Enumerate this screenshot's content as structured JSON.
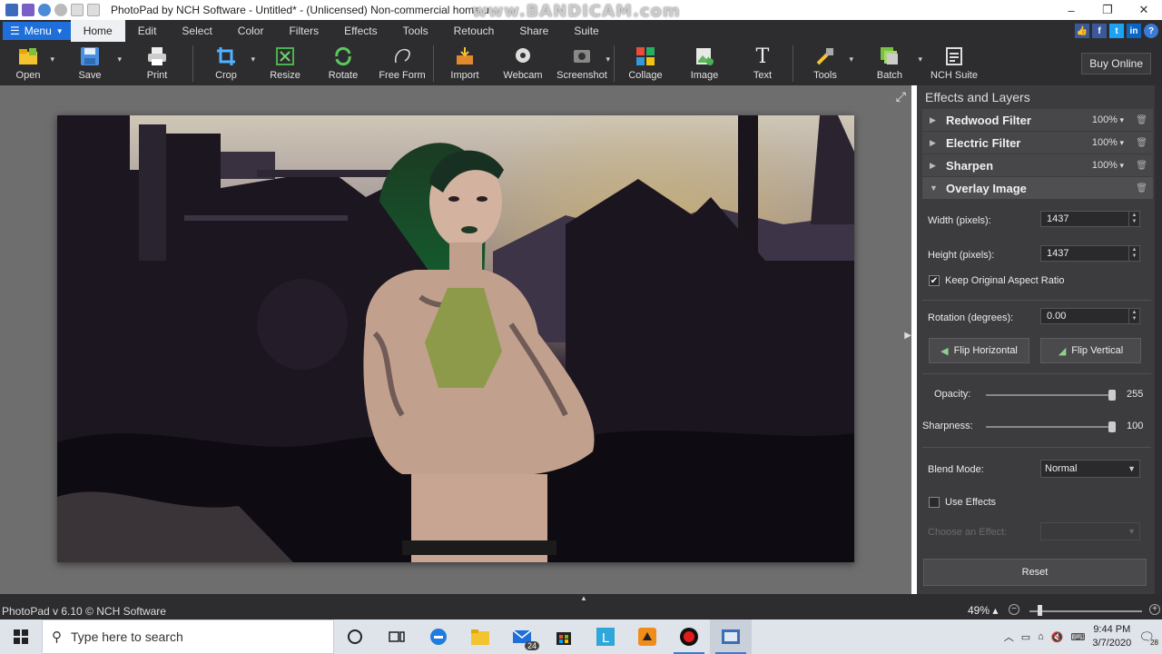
{
  "window": {
    "title": "PhotoPad by NCH Software - Untitled* - (Unlicensed) Non-commercial home u",
    "watermark": "www.BANDICAM.com",
    "minimize_glyph": "–",
    "maximize_glyph": "❐",
    "close_glyph": "✕"
  },
  "menubar": {
    "menu_label": "Menu",
    "tabs": [
      "Home",
      "Edit",
      "Select",
      "Color",
      "Filters",
      "Effects",
      "Tools",
      "Retouch",
      "Share",
      "Suite"
    ],
    "active_tab": "Home"
  },
  "toolbar": {
    "tools": [
      {
        "label": "Open",
        "icon": "folder-icon"
      },
      {
        "label": "Save",
        "icon": "save-icon"
      },
      {
        "label": "Print",
        "icon": "print-icon"
      },
      {
        "label": "Crop",
        "icon": "crop-icon"
      },
      {
        "label": "Resize",
        "icon": "resize-icon"
      },
      {
        "label": "Rotate",
        "icon": "rotate-icon"
      },
      {
        "label": "Free Form",
        "icon": "free-form-icon"
      },
      {
        "label": "Import",
        "icon": "import-icon"
      },
      {
        "label": "Webcam",
        "icon": "webcam-icon"
      },
      {
        "label": "Screenshot",
        "icon": "screenshot-icon"
      },
      {
        "label": "Collage",
        "icon": "collage-icon"
      },
      {
        "label": "Image",
        "icon": "image-icon"
      },
      {
        "label": "Text",
        "icon": "text-icon"
      },
      {
        "label": "Tools",
        "icon": "tools-icon"
      },
      {
        "label": "Batch",
        "icon": "batch-icon"
      },
      {
        "label": "NCH Suite",
        "icon": "nch-suite-icon"
      }
    ],
    "buy_online": "Buy Online"
  },
  "panel": {
    "title": "Effects and Layers",
    "layers": [
      {
        "name": "Redwood Filter",
        "percent": "100%"
      },
      {
        "name": "Electric Filter",
        "percent": "100%"
      },
      {
        "name": "Sharpen",
        "percent": "100%"
      },
      {
        "name": "Overlay Image",
        "percent": ""
      }
    ],
    "width_label": "Width (pixels):",
    "width_value": "1437",
    "height_label": "Height (pixels):",
    "height_value": "1437",
    "keep_aspect_label": "Keep Original Aspect Ratio",
    "keep_aspect_checked": true,
    "rotation_label": "Rotation (degrees):",
    "rotation_value": "0.00",
    "flip_h_label": "Flip Horizontal",
    "flip_v_label": "Flip Vertical",
    "opacity_label": "Opacity:",
    "opacity_value": "255",
    "opacity_fraction": 1.0,
    "sharpness_label": "Sharpness:",
    "sharpness_value": "100",
    "sharpness_fraction": 1.0,
    "blend_label": "Blend Mode:",
    "blend_value": "Normal",
    "use_effects_label": "Use Effects",
    "use_effects_checked": false,
    "choose_effect_label": "Choose an Effect:",
    "choose_effect_value": "",
    "reset_label": "Reset"
  },
  "statusbar": {
    "version_text": "PhotoPad v 6.10 © NCH Software",
    "zoom": "49%"
  },
  "taskbar": {
    "search_placeholder": "Type here to search",
    "mail_badge": "24",
    "time": "9:44 PM",
    "date": "3/7/2020",
    "notification_count": "28"
  },
  "colors": {
    "accent_blue": "#1e6fd9",
    "dark_chrome": "#2d2d30",
    "panel_bg": "#3c3c3f"
  }
}
